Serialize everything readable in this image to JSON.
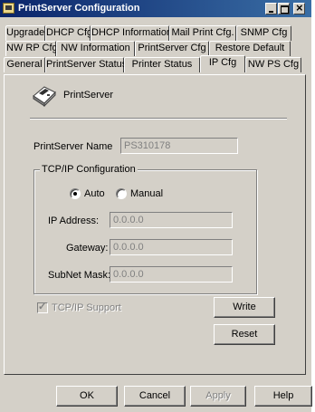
{
  "window": {
    "title": "PrintServer Configuration"
  },
  "tabs": {
    "row1": [
      "Upgrade",
      "DHCP Cfg",
      "DHCP Information",
      "Mail Print Cfg.",
      "SNMP Cfg"
    ],
    "row2": [
      "NW RP Cfg",
      "NW Information",
      "PrintServer Cfg",
      "Restore Default"
    ],
    "row3": [
      "General",
      "PrintServer Status",
      "Printer Status",
      "IP Cfg",
      "NW PS Cfg"
    ],
    "active": "IP Cfg"
  },
  "header": {
    "device_label": "PrintServer"
  },
  "form": {
    "printserver_name_label": "PrintServer Name",
    "printserver_name_value": "PS310178",
    "tcpip_group_label": "TCP/IP Configuration",
    "auto_label": "Auto",
    "manual_label": "Manual",
    "mode_selected": "Auto",
    "ip_address_label": "IP Address:",
    "ip_address_value": "0.0.0.0",
    "gateway_label": "Gateway:",
    "gateway_value": "0.0.0.0",
    "subnet_mask_label": "SubNet Mask:",
    "subnet_mask_value": "0.0.0.0",
    "tcpip_support_label": "TCP/IP Support",
    "write_label": "Write",
    "reset_label": "Reset"
  },
  "footer": {
    "ok_label": "OK",
    "cancel_label": "Cancel",
    "apply_label": "Apply",
    "help_label": "Help"
  }
}
